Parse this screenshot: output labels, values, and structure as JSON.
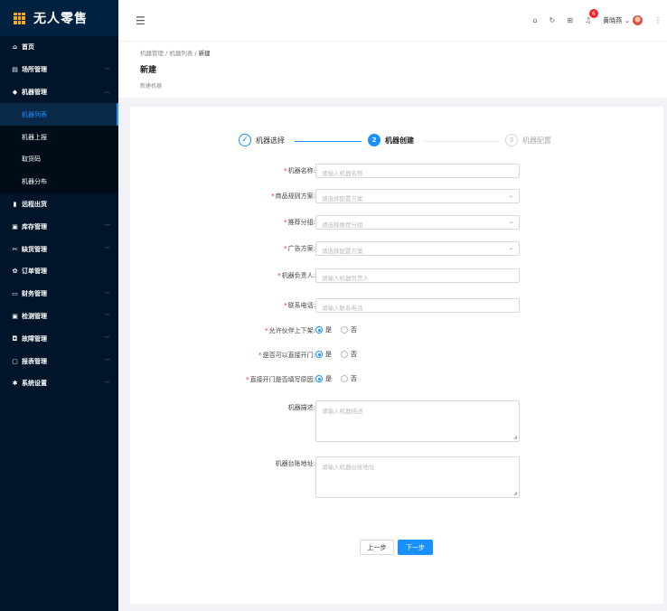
{
  "app": {
    "title": "无人零售"
  },
  "sidebar": {
    "items": [
      {
        "label": "首页",
        "icon": "home-icon",
        "glyph": "⌂",
        "expandable": false
      },
      {
        "label": "场所管理",
        "icon": "building-icon",
        "glyph": "▤",
        "expandable": true
      },
      {
        "label": "机器管理",
        "icon": "machine-icon",
        "glyph": "◆",
        "expandable": true,
        "expanded": true
      },
      {
        "label": "机器列表",
        "sub": true,
        "active": true
      },
      {
        "label": "机器上报",
        "sub": true
      },
      {
        "label": "取货码",
        "sub": true
      },
      {
        "label": "机器分布",
        "sub": true
      },
      {
        "label": "远程出货",
        "icon": "remote-icon",
        "glyph": "▮",
        "expandable": false
      },
      {
        "label": "库存管理",
        "icon": "inventory-icon",
        "glyph": "▣",
        "expandable": true
      },
      {
        "label": "缺货管理",
        "icon": "shortage-icon",
        "glyph": "✂",
        "expandable": true
      },
      {
        "label": "订单管理",
        "icon": "order-icon",
        "glyph": "✿",
        "expandable": false
      },
      {
        "label": "财务管理",
        "icon": "finance-icon",
        "glyph": "▭",
        "expandable": true
      },
      {
        "label": "检测管理",
        "icon": "monitor-icon",
        "glyph": "▣",
        "expandable": true
      },
      {
        "label": "故障管理",
        "icon": "fault-icon",
        "glyph": "◘",
        "expandable": true
      },
      {
        "label": "报表管理",
        "icon": "report-icon",
        "glyph": "▢",
        "expandable": true
      },
      {
        "label": "系统设置",
        "icon": "settings-icon",
        "glyph": "✱",
        "expandable": true
      }
    ]
  },
  "header": {
    "user_name": "黄晓燕",
    "notification_count": "6"
  },
  "breadcrumb": [
    "机器管理",
    "机器列表",
    "新建"
  ],
  "page": {
    "title": "新建",
    "subtitle": "新建机器"
  },
  "steps": [
    {
      "label": "机器选择",
      "state": "done",
      "marker": "✓"
    },
    {
      "label": "机器创建",
      "state": "current",
      "marker": "2"
    },
    {
      "label": "机器配置",
      "state": "wait",
      "marker": "3"
    }
  ],
  "form": {
    "name": {
      "label": "机器名称:",
      "placeholder": "请输入机器名称",
      "required": true
    },
    "product_plan": {
      "label": "商品规则方案:",
      "placeholder": "请选择配置方案",
      "required": true
    },
    "recommend_group": {
      "label": "推荐分组:",
      "placeholder": "请选择推荐分组",
      "required": true
    },
    "ad_plan": {
      "label": "广告方案:",
      "placeholder": "请选择配置方案",
      "required": true
    },
    "owner": {
      "label": "机器负责人:",
      "placeholder": "请输入机器负责人",
      "required": true
    },
    "phone": {
      "label": "联系电话:",
      "placeholder": "请输入联系电话",
      "required": true
    },
    "partner_shelf": {
      "label": "允许伙伴上下架:",
      "options": [
        "是",
        "否"
      ],
      "selected": "是",
      "required": true
    },
    "direct_open": {
      "label": "是否可以直接开门:",
      "options": [
        "是",
        "否"
      ],
      "selected": "是",
      "required": true
    },
    "reason_required": {
      "label": "直接开门是否填写原因:",
      "options": [
        "是",
        "否"
      ],
      "selected": "是",
      "required": true
    },
    "description": {
      "label": "机器描述:",
      "placeholder": "请输入机器描述"
    },
    "address": {
      "label": "机器台账地址:",
      "placeholder": "请输入机器台账地址"
    }
  },
  "buttons": {
    "prev": "上一步",
    "next": "下一步"
  },
  "colors": {
    "primary": "#1890ff",
    "sidebar": "#001529",
    "badge": "#f5222d"
  }
}
